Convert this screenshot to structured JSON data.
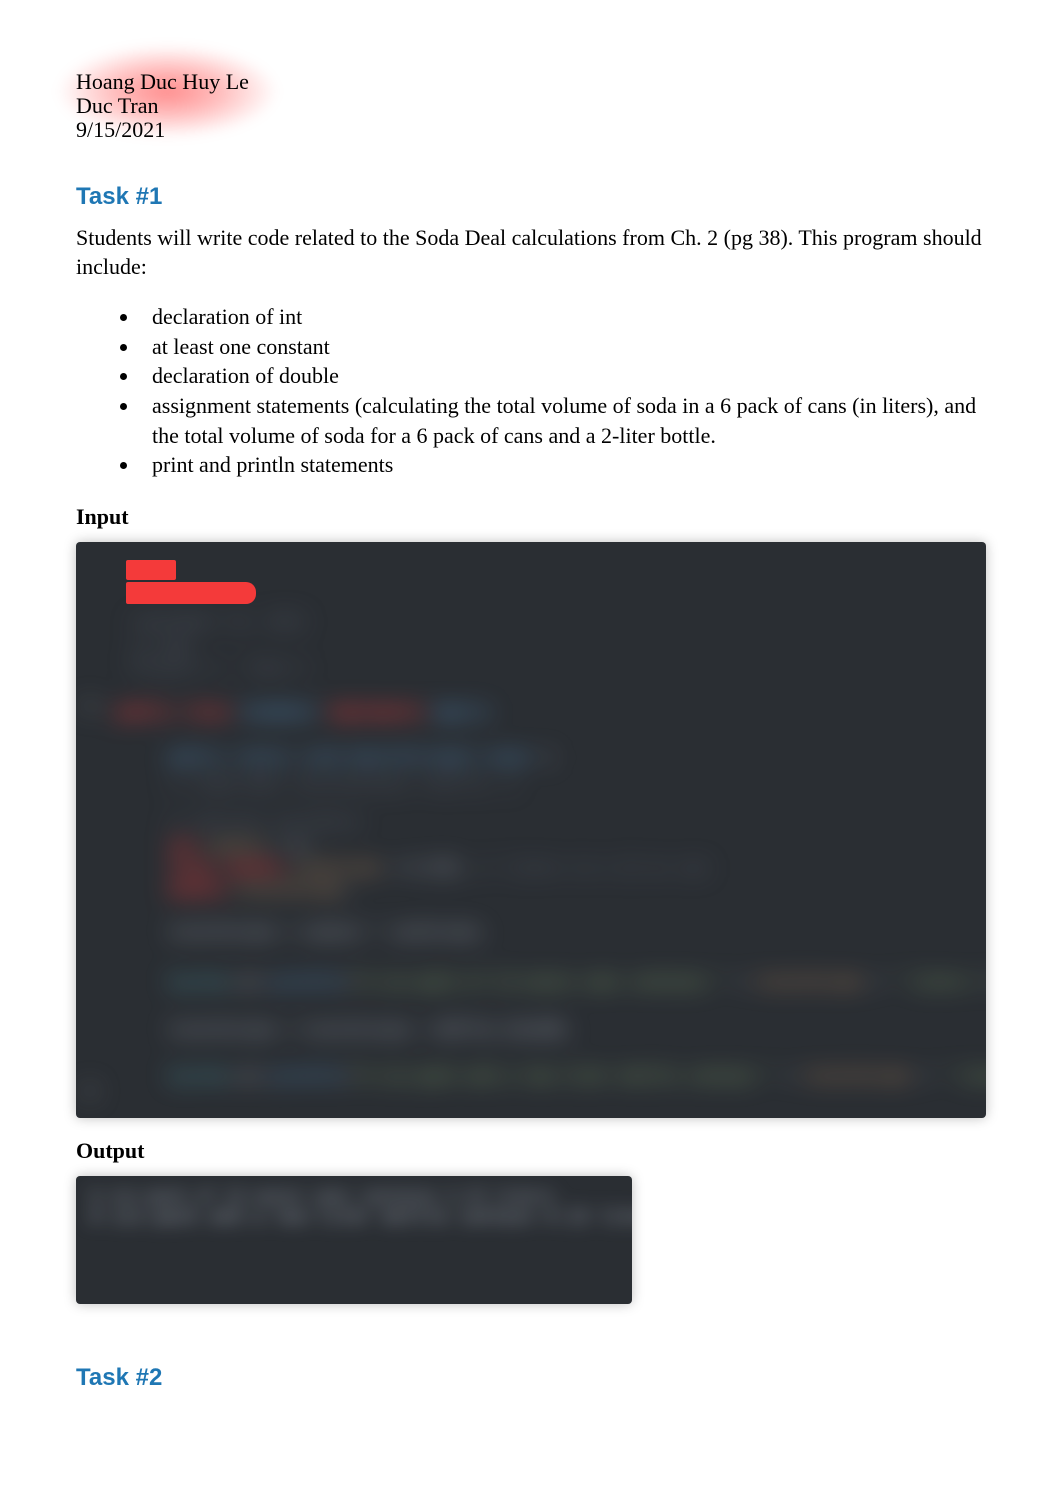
{
  "header": {
    "name1": "Hoang Duc Huy Le",
    "name2": "Duc Tran",
    "date": "9/15/2021"
  },
  "task1": {
    "heading": "Task #1",
    "intro": "Students will write code related to the Soda Deal calculations from Ch. 2 (pg 38). This program should include:",
    "bullets": [
      "declaration of int",
      "at least one constant",
      "declaration of double",
      "assignment statements (calculating the total volume of soda in a 6 pack of cans (in liters), and the total volume of soda for a 6 pack of cans and a 2-liter bottle.",
      "print and println statements"
    ],
    "input_label": "Input",
    "output_label": "Output"
  },
  "task2": {
    "heading": "Task #2"
  }
}
